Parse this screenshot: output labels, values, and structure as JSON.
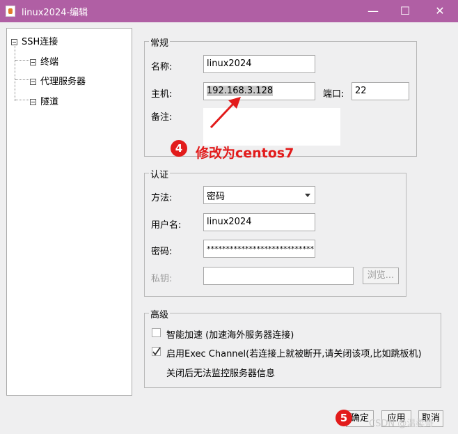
{
  "window": {
    "title": "linux2024-编辑",
    "minimize": "—",
    "maximize": "☐",
    "close": "✕",
    "titlebar_color": "#b05fa4"
  },
  "tree": {
    "root": "SSH连接",
    "items": [
      "终端",
      "代理服务器",
      "隧道"
    ]
  },
  "general": {
    "title": "常规",
    "name_label": "名称:",
    "name_value": "linux2024",
    "host_label": "主机:",
    "host_value": "192.168.3.128",
    "port_label": "端口:",
    "port_value": "22",
    "note_label": "备注:"
  },
  "auth": {
    "title": "认证",
    "method_label": "方法:",
    "method_value": "密码",
    "username_label": "用户名:",
    "username_value": "linux2024",
    "password_label": "密码:",
    "password_value": "****************************",
    "key_label": "私钥:",
    "browse_label": "浏览..."
  },
  "advanced": {
    "title": "高级",
    "smart_accel_label": "智能加速 (加速海外服务器连接)",
    "smart_accel_checked": false,
    "exec_channel_label": "启用Exec Channel(若连接上就被断开,请关闭该项,比如跳板机)",
    "exec_channel_checked": true,
    "exec_channel_note": "关闭后无法监控服务器信息"
  },
  "footer": {
    "ok_label": "确定",
    "apply_label": "应用",
    "cancel_label": "取消"
  },
  "annotations": {
    "step4_number": "4",
    "step4_text": "修改为centos7",
    "step5_number": "5",
    "color": "#e21b1b"
  },
  "watermark": "CSDN @温柔哥"
}
